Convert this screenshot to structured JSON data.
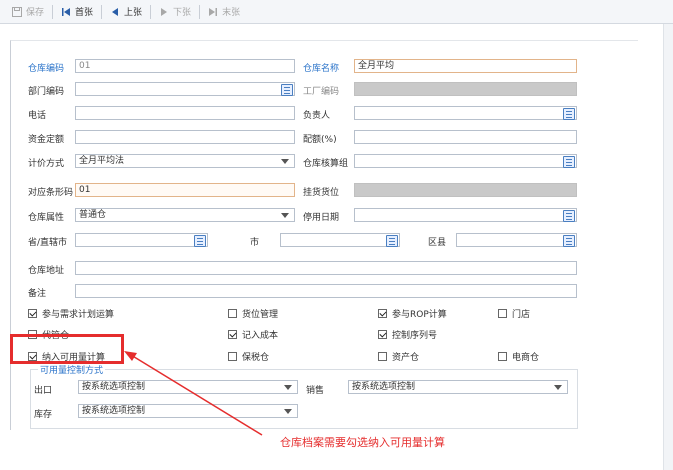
{
  "toolbar": {
    "save": "保存",
    "first": "首张",
    "prev": "上张",
    "next": "下张",
    "last": "末张"
  },
  "form": {
    "code_label": "仓库编码",
    "code_value": "01",
    "name_label": "仓库名称",
    "name_value": "全月平均",
    "dept_label": "部门编码",
    "factory_label": "工厂编码",
    "phone_label": "电话",
    "owner_label": "负责人",
    "fund_label": "资金定额",
    "ratio_label": "配额(%)",
    "pricing_label": "计价方式",
    "pricing_value": "全月平均法",
    "calc_group_label": "仓库核算组",
    "barcode_label": "对应条形码",
    "barcode_value": "01",
    "bin_label": "挂货货位",
    "attr_label": "仓库属性",
    "attr_value": "普通仓",
    "stop_date_label": "停用日期",
    "province_label": "省/直辖市",
    "city_label": "市",
    "district_label": "区县",
    "address_label": "仓库地址",
    "note_label": "备注"
  },
  "checkboxes": {
    "mrp": "参与需求计划运算",
    "bin_mgmt": "货位管理",
    "rop": "参与ROP计算",
    "store": "门店",
    "agent": "代管仓",
    "cost": "记入成本",
    "serial": "控制序列号",
    "available": "纳入可用量计算",
    "bonded": "保税仓",
    "asset": "资产仓",
    "ecommerce": "电商仓"
  },
  "availability": {
    "group_title": "可用量控制方式",
    "out_label": "出口",
    "out_value": "按系统选项控制",
    "sales_label": "销售",
    "sales_value": "按系统选项控制",
    "stock_label": "库存",
    "stock_value": "按系统选项控制"
  },
  "annotation": "仓库档案需要勾选纳入可用量计算",
  "colors": {
    "accent_blue": "#2a73c9",
    "highlight_red": "#e52d2d"
  }
}
